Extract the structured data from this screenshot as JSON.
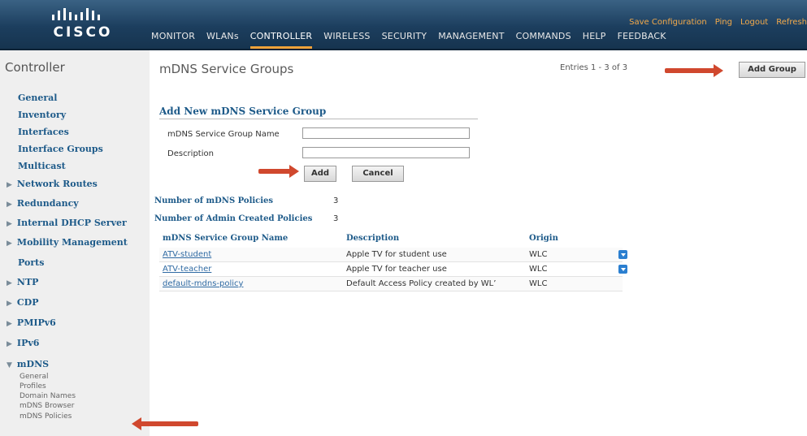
{
  "header": {
    "brand": "CISCO",
    "util_links": [
      "Save Configuration",
      "Ping",
      "Logout",
      "Refresh"
    ],
    "nav": [
      "MONITOR",
      "WLANs",
      "CONTROLLER",
      "WIRELESS",
      "SECURITY",
      "MANAGEMENT",
      "COMMANDS",
      "HELP",
      "FEEDBACK"
    ],
    "active_nav": "CONTROLLER",
    "accent_color": "#f0a23a"
  },
  "sidebar": {
    "title": "Controller",
    "items": [
      {
        "label": "General",
        "expandable": false
      },
      {
        "label": "Inventory",
        "expandable": false
      },
      {
        "label": "Interfaces",
        "expandable": false
      },
      {
        "label": "Interface Groups",
        "expandable": false
      },
      {
        "label": "Multicast",
        "expandable": false
      },
      {
        "label": "Network Routes",
        "expandable": true
      },
      {
        "label": "Redundancy",
        "expandable": true
      },
      {
        "label": "Internal DHCP Server",
        "expandable": true
      },
      {
        "label": "Mobility Management",
        "expandable": true
      },
      {
        "label": "Ports",
        "expandable": false
      },
      {
        "label": "NTP",
        "expandable": true
      },
      {
        "label": "CDP",
        "expandable": true
      },
      {
        "label": "PMIPv6",
        "expandable": true
      },
      {
        "label": "IPv6",
        "expandable": true
      },
      {
        "label": "mDNS",
        "expandable": true,
        "expanded": true
      }
    ],
    "mdns_subitems": [
      "General",
      "Profiles",
      "Domain Names",
      "mDNS Browser",
      "mDNS Policies"
    ]
  },
  "main": {
    "title": "mDNS Service Groups",
    "entries": "Entries 1 - 3 of 3",
    "add_group_label": "Add Group",
    "form": {
      "section_title": "Add New mDNS Service Group",
      "name_label": "mDNS Service Group Name",
      "name_value": "",
      "desc_label": "Description",
      "desc_value": "",
      "add_label": "Add",
      "cancel_label": "Cancel"
    },
    "stats": {
      "policies_label": "Number of mDNS Policies",
      "policies_value": "3",
      "admin_label": "Number of Admin Created Policies",
      "admin_value": "3"
    },
    "table": {
      "headers": [
        "mDNS Service Group Name",
        "Description",
        "Origin"
      ],
      "rows": [
        {
          "name": "ATV-student",
          "description": "Apple TV for student use",
          "origin": "WLC",
          "has_menu": true
        },
        {
          "name": "ATV-teacher",
          "description": "Apple TV for teacher use",
          "origin": "WLC",
          "has_menu": true
        },
        {
          "name": "default-mdns-policy",
          "description": "Default Access Policy created by WL’",
          "origin": "WLC",
          "has_menu": false
        }
      ]
    }
  }
}
